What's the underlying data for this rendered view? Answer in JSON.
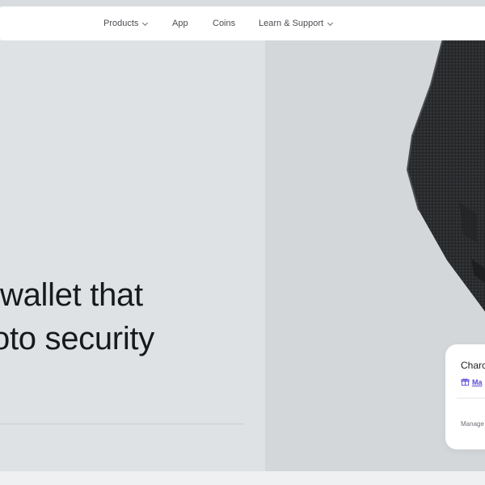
{
  "nav": {
    "items": [
      {
        "label": "Products",
        "has_dropdown": true
      },
      {
        "label": "App",
        "has_dropdown": false
      },
      {
        "label": "Coins",
        "has_dropdown": false
      },
      {
        "label": "Learn & Support",
        "has_dropdown": true
      }
    ]
  },
  "hero": {
    "headline_line1": "wallet that",
    "headline_line2": "oto security"
  },
  "card": {
    "title": "Charc",
    "link_label": "Ma",
    "link_icon": "gift-icon",
    "footer": "Manage"
  },
  "colors": {
    "nav_bg": "#ffffff",
    "hero_left_bg": "#dfe2e5",
    "hero_right_bg": "#d4d7da",
    "headline": "#17191c",
    "link_accent": "#5b4bdb",
    "device": "#2b2c2e"
  }
}
